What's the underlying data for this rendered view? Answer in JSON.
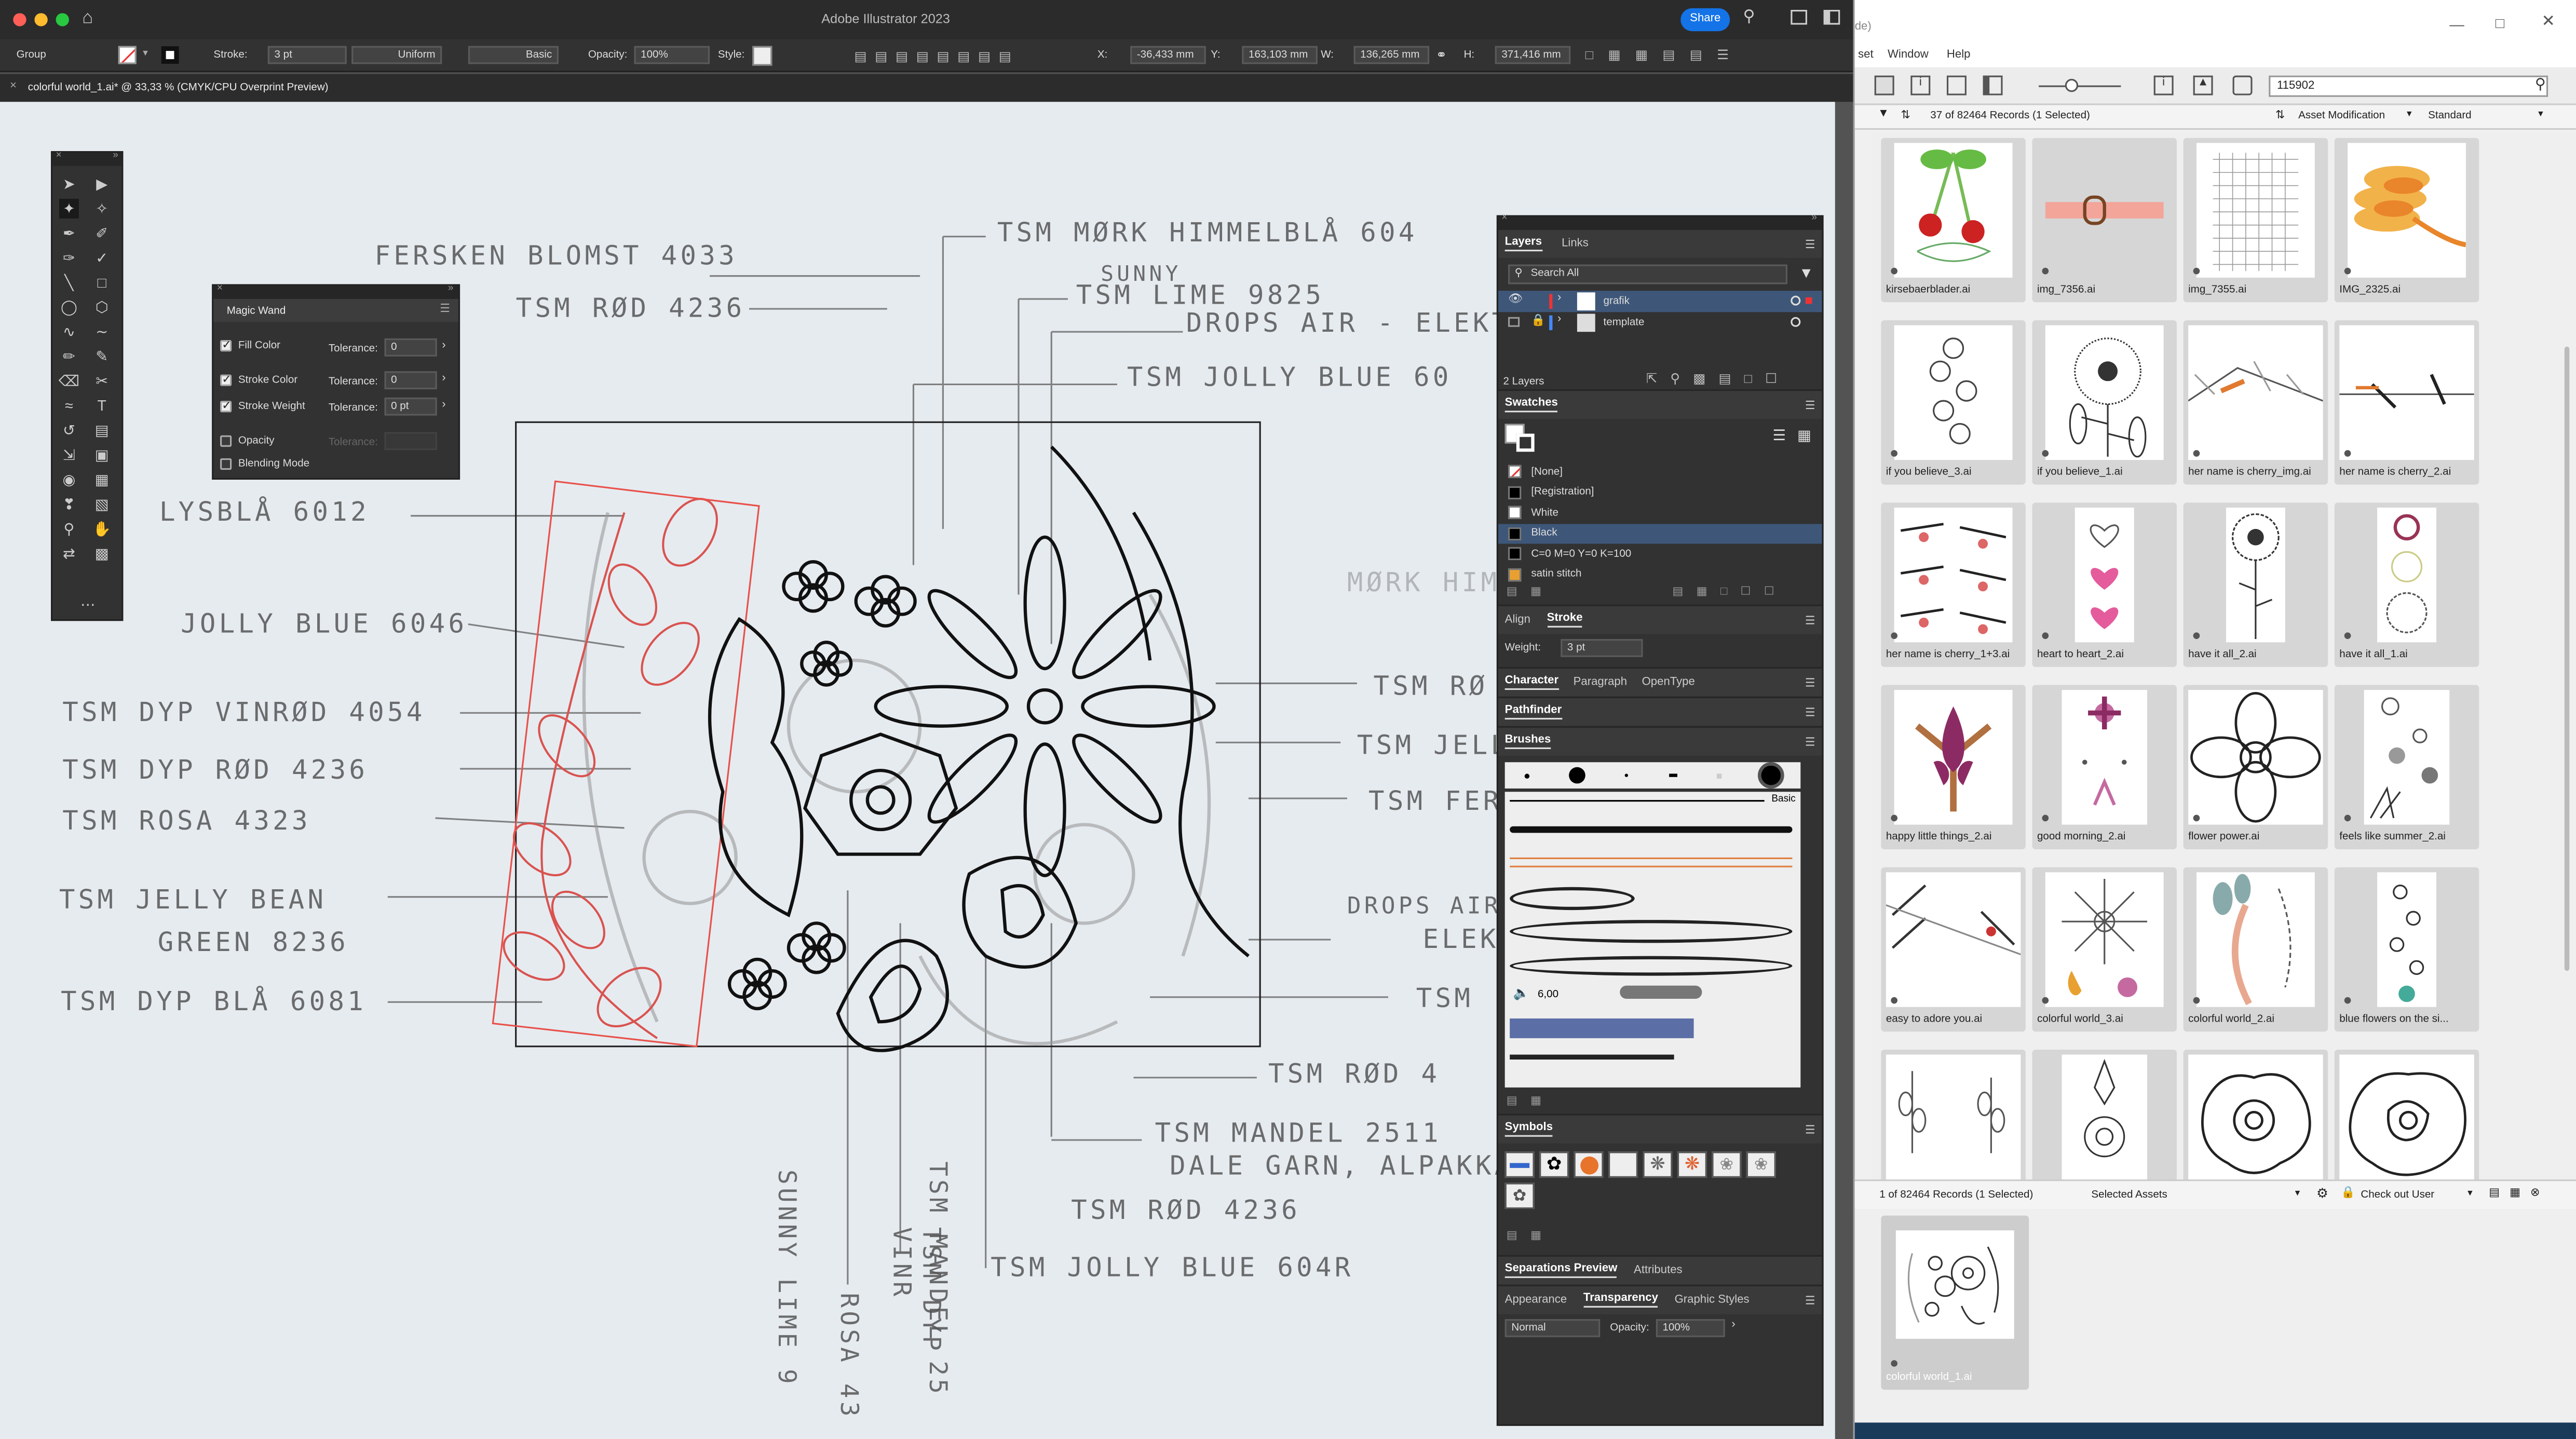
{
  "titlebar": {
    "app_title": "Adobe Illustrator 2023",
    "share": "Share"
  },
  "control_bar": {
    "selection": "Group",
    "stroke_label": "Stroke:",
    "stroke_value": "3 pt",
    "profile": "Uniform",
    "brush": "Basic",
    "opacity_label": "Opacity:",
    "opacity_value": "100%",
    "style_label": "Style:",
    "x_label": "X:",
    "x_value": "-36,433 mm",
    "y_label": "Y:",
    "y_value": "163,103 mm",
    "w_label": "W:",
    "w_value": "136,265 mm",
    "h_label": "H:",
    "h_value": "371,416 mm"
  },
  "doc_tab": {
    "title": "colorful world_1.ai* @ 33,33 % (CMYK/CPU Overprint Preview)"
  },
  "magic_wand": {
    "title": "Magic Wand",
    "fill_color": "Fill Color",
    "stroke_color": "Stroke Color",
    "stroke_weight": "Stroke Weight",
    "opacity": "Opacity",
    "blending": "Blending Mode",
    "tolerance": "Tolerance:",
    "fill_tol": "0",
    "stroke_tol": "0",
    "weight_tol": "0 pt"
  },
  "sketch_notes": [
    "FERSKEN BLOMST 4033",
    "TSM RØD 4236",
    "TSM MØRK HIMMELBLÅ 604",
    "SUNNY",
    "TSM LIME 9825",
    "DROPS AIR - ELEKTRIS",
    "TSM JOLLY BLUE 60",
    "LYSBLÅ 6012",
    "JOLLY BLUE 6046",
    "TSM DYP VINRØD 4054",
    "TSM DYP RØD 4236",
    "TSM ROSA 4323",
    "TSM JELLY BEAN",
    "GREEN 8236",
    "TSM DYP BLÅ 6081",
    "TSM RØ",
    "TSM JELL",
    "TSM FER",
    "DROPS AIR",
    "ELEK",
    "TSM",
    "MØRK HIM",
    "TSM RØD 4",
    "TSM MANDEL 2511",
    "DALE GARN, ALPAKKA",
    "TSM RØD 4236",
    "TSM JOLLY BLUE 604R",
    "SUNNY LIME 9",
    "ROSA 43",
    "TSM DYP VINR",
    "TSM MANDEL 25"
  ],
  "layers_panel": {
    "tab_layers": "Layers",
    "tab_links": "Links",
    "search": "Search All",
    "layers": [
      {
        "name": "grafik"
      },
      {
        "name": "template"
      }
    ],
    "count": "2 Layers"
  },
  "swatches_panel": {
    "title": "Swatches",
    "items": [
      {
        "name": "[None]",
        "color": "#ffffff"
      },
      {
        "name": "[Registration]",
        "color": "#000000"
      },
      {
        "name": "White",
        "color": "#ffffff"
      },
      {
        "name": "Black",
        "color": "#000000"
      },
      {
        "name": "C=0 M=0 Y=0 K=100",
        "color": "#000000"
      },
      {
        "name": "satin stitch",
        "color": "#e8a030"
      }
    ]
  },
  "align_stroke": {
    "tab_align": "Align",
    "tab_stroke": "Stroke",
    "weight_label": "Weight:",
    "weight_value": "3 pt"
  },
  "char_tabs": {
    "character": "Character",
    "paragraph": "Paragraph",
    "opentype": "OpenType"
  },
  "pathfinder": {
    "title": "Pathfinder"
  },
  "brushes": {
    "title": "Brushes",
    "basic": "Basic",
    "size": "6,00"
  },
  "symbols": {
    "title": "Symbols"
  },
  "bottom_tabs": {
    "separations": "Separations Preview",
    "attributes": "Attributes",
    "appearance": "Appearance",
    "transparency": "Transparency",
    "graphic_styles": "Graphic Styles",
    "blend_mode": "Normal",
    "opacity_label": "Opacity:",
    "opacity_value": "100%"
  },
  "bridge": {
    "menu": [
      "set",
      "Window",
      "Help"
    ],
    "search": "115902",
    "records": "37 of 82464 Records (1 Selected)",
    "filter": "Asset Modification",
    "view": "Standard",
    "footer_records": "1 of 82464 Records (1 Selected)",
    "selected_assets": "Selected Assets",
    "checkout": "Check out User",
    "thumbs": [
      "kirsebaerblader.ai",
      "img_7356.ai",
      "img_7355.ai",
      "IMG_2325.ai",
      "if you believe_3.ai",
      "if you believe_1.ai",
      "her name is cherry_img.ai",
      "her name is cherry_2.ai",
      "her name is cherry_1+3.ai",
      "heart to heart_2.ai",
      "have it all_2.ai",
      "have it all_1.ai",
      "happy little things_2.ai",
      "good morning_2.ai",
      "flower power.ai",
      "feels like summer_2.ai",
      "easy to adore you.ai",
      "colorful world_3.ai",
      "colorful world_2.ai",
      "blue flowers on the si...",
      "",
      "",
      "",
      ""
    ],
    "selected_thumb": "colorful world_1.ai"
  },
  "colors": {
    "accent": "#1473e6",
    "selection_red": "#e8514a",
    "panel_dark": "#323232"
  }
}
